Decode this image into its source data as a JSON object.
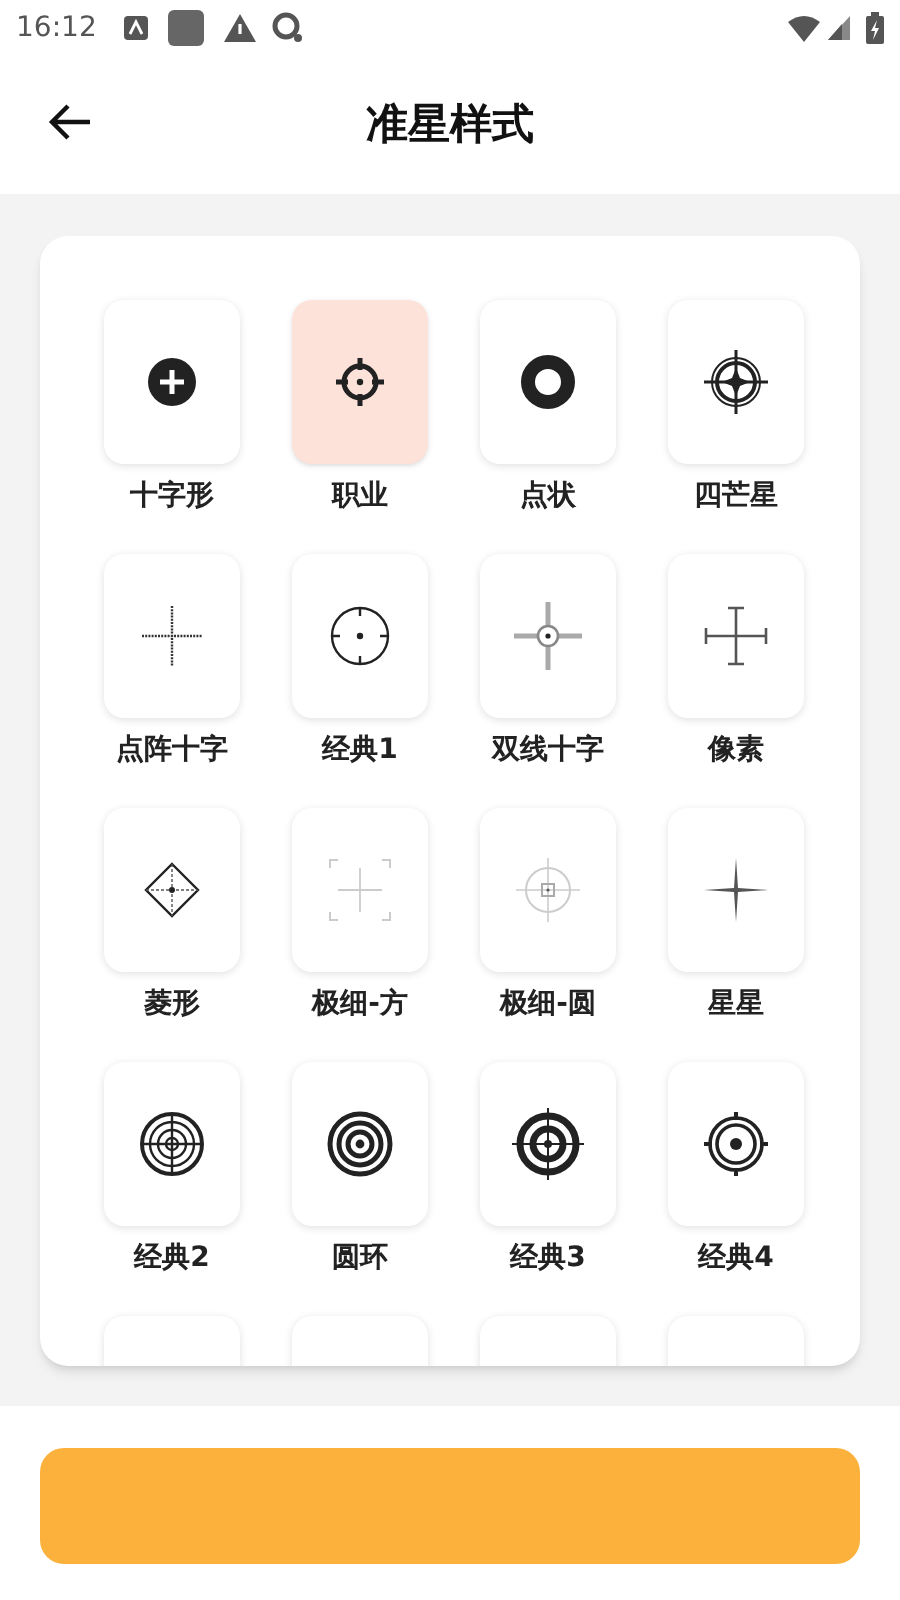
{
  "status_bar": {
    "time": "16:12"
  },
  "header": {
    "title": "准星样式"
  },
  "styles": [
    {
      "label": "十字形",
      "kind": "cross",
      "selected": false
    },
    {
      "label": "职业",
      "kind": "pro",
      "selected": true
    },
    {
      "label": "点状",
      "kind": "dot",
      "selected": false
    },
    {
      "label": "四芒星",
      "kind": "star4",
      "selected": false
    },
    {
      "label": "点阵十字",
      "kind": "dotted-cross",
      "selected": false
    },
    {
      "label": "经典1",
      "kind": "classic1",
      "selected": false
    },
    {
      "label": "双线十字",
      "kind": "double-cross",
      "selected": false
    },
    {
      "label": "像素",
      "kind": "pixel",
      "selected": false
    },
    {
      "label": "菱形",
      "kind": "diamond",
      "selected": false
    },
    {
      "label": "极细-方",
      "kind": "thin-square",
      "selected": false
    },
    {
      "label": "极细-圆",
      "kind": "thin-circle",
      "selected": false
    },
    {
      "label": "星星",
      "kind": "star",
      "selected": false
    },
    {
      "label": "经典2",
      "kind": "classic2",
      "selected": false
    },
    {
      "label": "圆环",
      "kind": "rings",
      "selected": false
    },
    {
      "label": "经典3",
      "kind": "classic3",
      "selected": false
    },
    {
      "label": "经典4",
      "kind": "classic4",
      "selected": false
    },
    {
      "kind": "cut",
      "selected": false
    },
    {
      "kind": "cut",
      "selected": false
    },
    {
      "kind": "cut",
      "selected": false
    },
    {
      "kind": "cut",
      "selected": false
    }
  ],
  "confirm_button": {
    "kind": "button"
  }
}
